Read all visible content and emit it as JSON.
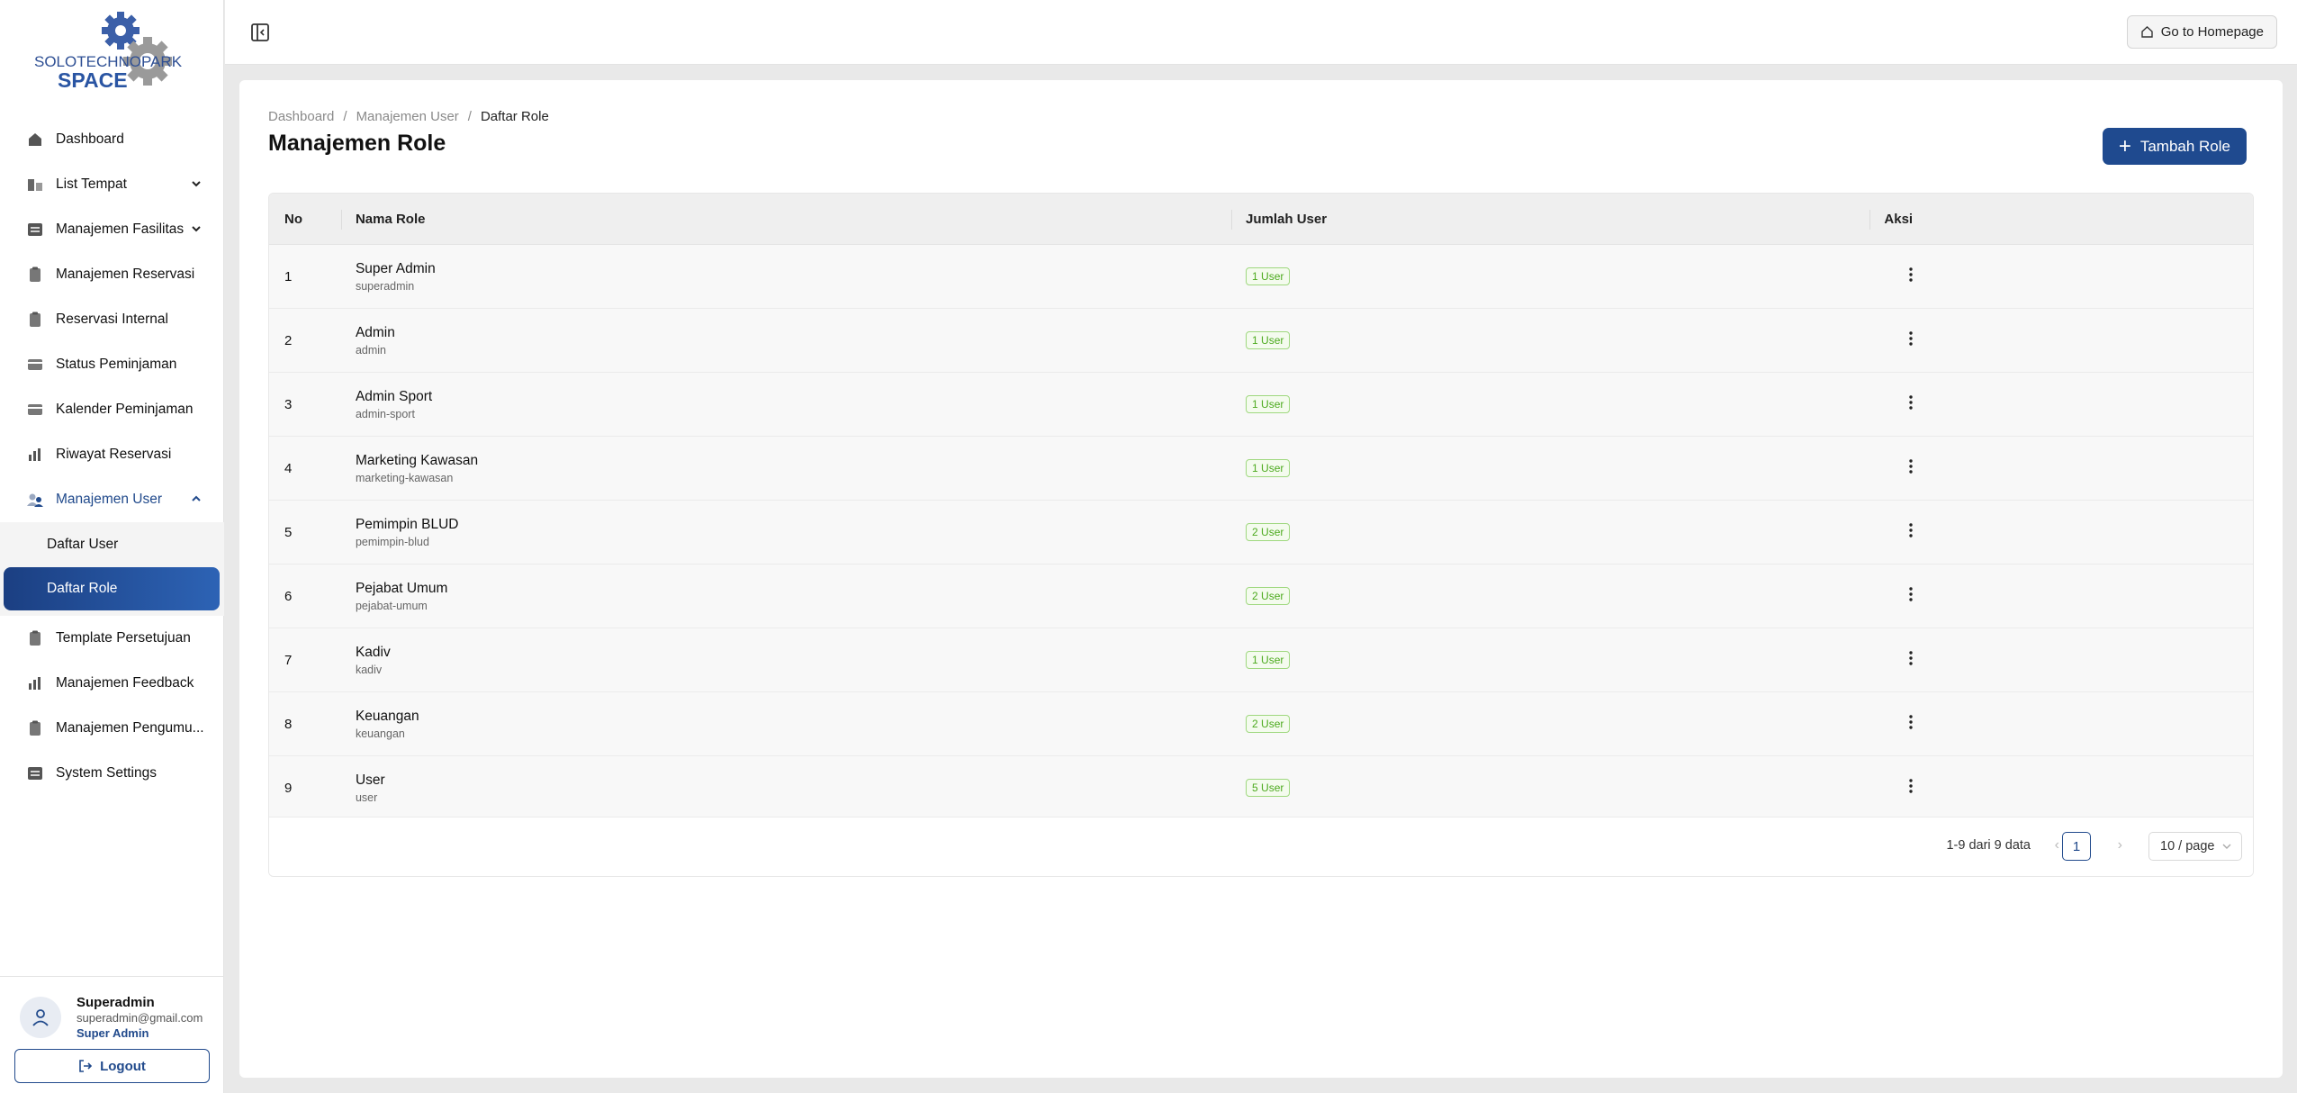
{
  "brand": {
    "line1": "SOLOTECHNOPARK",
    "line2": "SPACE"
  },
  "sidebar": {
    "items": [
      {
        "label": "Dashboard",
        "icon": "home-icon"
      },
      {
        "label": "List Tempat",
        "icon": "building-icon",
        "has_children": true
      },
      {
        "label": "Manajemen Fasilitas",
        "icon": "swap-icon",
        "has_children": true
      },
      {
        "label": "Manajemen Reservasi",
        "icon": "clipboard-icon"
      },
      {
        "label": "Reservasi Internal",
        "icon": "clipboard-icon"
      },
      {
        "label": "Status Peminjaman",
        "icon": "card-icon"
      },
      {
        "label": "Kalender Peminjaman",
        "icon": "card-icon"
      },
      {
        "label": "Riwayat Reservasi",
        "icon": "bar-chart-icon"
      },
      {
        "label": "Manajemen User",
        "icon": "users-icon",
        "expanded": true,
        "children": [
          {
            "label": "Daftar User"
          },
          {
            "label": "Daftar Role",
            "selected": true
          }
        ]
      },
      {
        "label": "Template Persetujuan",
        "icon": "clipboard-icon"
      },
      {
        "label": "Manajemen Feedback",
        "icon": "bar-chart-icon"
      },
      {
        "label": "Manajemen Pengumu...",
        "icon": "clipboard-icon"
      },
      {
        "label": "System Settings",
        "icon": "swap-icon"
      }
    ]
  },
  "user": {
    "name": "Superadmin",
    "email": "superadmin@gmail.com",
    "role": "Super Admin",
    "logout_label": "Logout"
  },
  "topbar": {
    "home_label": "Go to Homepage"
  },
  "breadcrumb": [
    "Dashboard",
    "Manajemen User",
    "Daftar Role"
  ],
  "page": {
    "title": "Manajemen Role",
    "add_label": "Tambah Role"
  },
  "table": {
    "headers": [
      "No",
      "Nama Role",
      "Jumlah User",
      "Aksi"
    ],
    "rows": [
      {
        "no": "1",
        "name": "Super Admin",
        "slug": "superadmin",
        "users": "1 User"
      },
      {
        "no": "2",
        "name": "Admin",
        "slug": "admin",
        "users": "1 User"
      },
      {
        "no": "3",
        "name": "Admin Sport",
        "slug": "admin-sport",
        "users": "1 User"
      },
      {
        "no": "4",
        "name": "Marketing Kawasan",
        "slug": "marketing-kawasan",
        "users": "1 User"
      },
      {
        "no": "5",
        "name": "Pemimpin BLUD",
        "slug": "pemimpin-blud",
        "users": "2 User"
      },
      {
        "no": "6",
        "name": "Pejabat Umum",
        "slug": "pejabat-umum",
        "users": "2 User"
      },
      {
        "no": "7",
        "name": "Kadiv",
        "slug": "kadiv",
        "users": "1 User"
      },
      {
        "no": "8",
        "name": "Keuangan",
        "slug": "keuangan",
        "users": "2 User"
      },
      {
        "no": "9",
        "name": "User",
        "slug": "user",
        "users": "5 User"
      }
    ]
  },
  "pagination": {
    "info": "1-9 dari 9 data",
    "prev": "‹",
    "current_page": "1",
    "next": "›",
    "page_size": "10 / page"
  },
  "colors": {
    "primary": "#1f4a8f",
    "badge_green": "#4caa1e"
  }
}
